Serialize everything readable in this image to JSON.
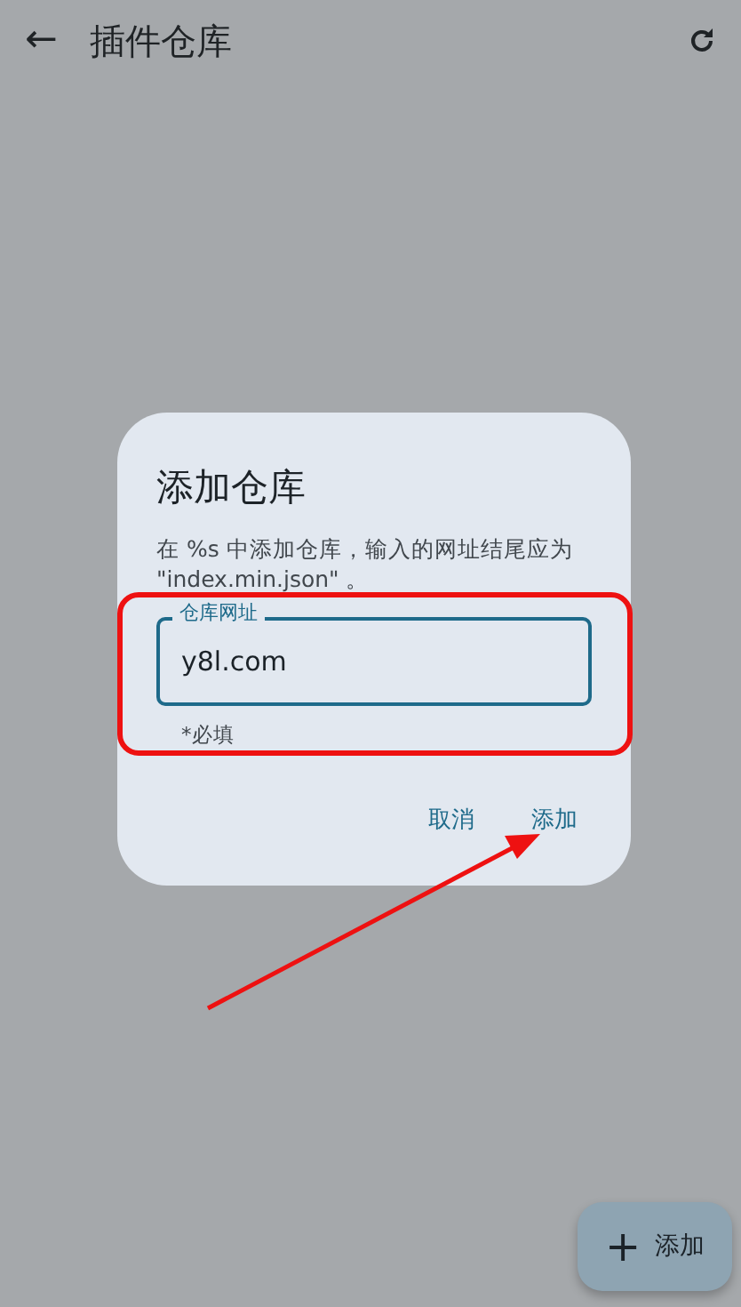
{
  "app_bar": {
    "back_icon": "←",
    "title": "插件仓库"
  },
  "dialog": {
    "title": "添加仓库",
    "message": "在 %s 中添加仓库，输入的网址结尾应为 \"index.min.json\" 。",
    "field": {
      "label": "仓库网址",
      "value": "y8l.com",
      "helper": "*必填"
    },
    "buttons": [
      {
        "label": "取消"
      },
      {
        "label": "添加"
      }
    ]
  },
  "fab": {
    "icon": "+",
    "label": "添加"
  }
}
